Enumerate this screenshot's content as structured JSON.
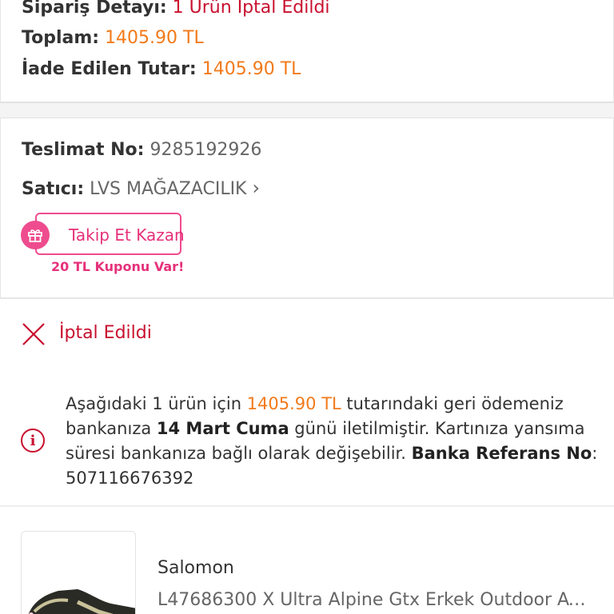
{
  "summary": {
    "order_detail_label": "Sipariş Detayı:",
    "order_detail_value": "1 Ürün İptal Edildi",
    "total_label": "Toplam:",
    "total_value": "1405.90 TL",
    "refund_label": "İade Edilen Tutar:",
    "refund_value": "1405.90 TL"
  },
  "delivery": {
    "delivery_no_label": "Teslimat No:",
    "delivery_no_value": "9285192926",
    "seller_label": "Satıcı:",
    "seller_value": "LVS MAĞAZACILIK",
    "seller_chevron": "›",
    "follow_button_label": "Takip Et Kazan",
    "coupon_text": "20 TL Kuponu Var!"
  },
  "status": {
    "label": "İptal Edildi"
  },
  "refund_info": {
    "part1": "Aşağıdaki 1 ürün için ",
    "amount": "1405.90 TL",
    "part2": " tutarındaki geri ödemeniz bankanıza ",
    "date": "14 Mart Cuma",
    "part3": " günü iletilmiştir. Kartınıza yansıma süresi bankanıza bağlı olarak değişebilir. ",
    "reference_label": "Banka Referans No",
    "part4": ": ",
    "reference_value": "507116676392"
  },
  "product": {
    "brand": "Salomon",
    "name": "L47686300 X Ultra Alpine Gtx Erkek Outdoor Ayakkabı"
  },
  "colors": {
    "red": "#c8102e",
    "orange": "#f27a1a",
    "pink": "#ee4c8e"
  },
  "icons": {
    "seller_chevron": "chevron-right-icon",
    "follow": "gift-icon",
    "status": "close-icon",
    "info": "info-icon"
  }
}
